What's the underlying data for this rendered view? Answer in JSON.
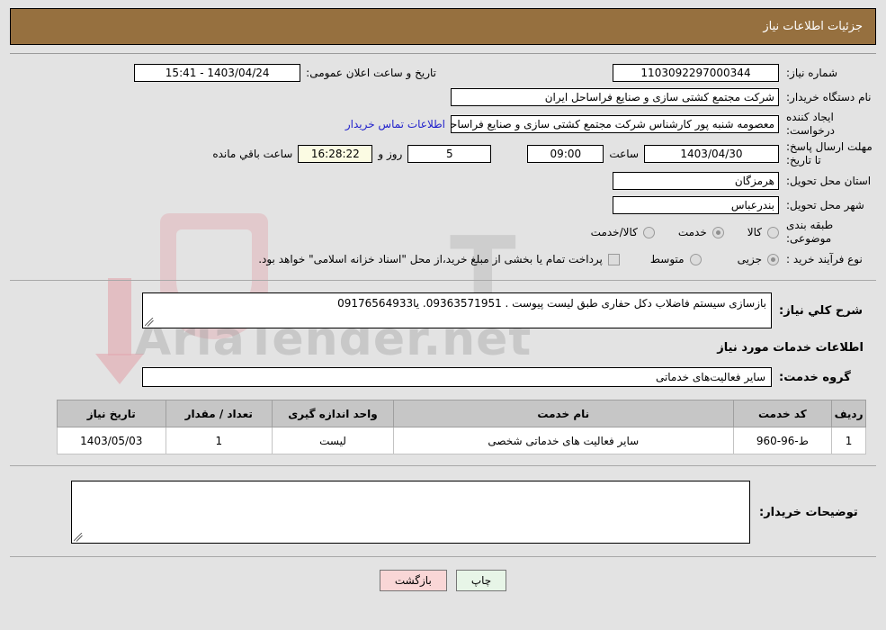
{
  "header": {
    "title": "جزئیات اطلاعات نیاز"
  },
  "details": {
    "need_number_label": "شماره نیاز:",
    "need_number_value": "1103092297000344",
    "public_announce_label": "تاریخ و ساعت اعلان عمومی:",
    "public_announce_value": "1403/04/24 - 15:41",
    "buyer_org_label": "نام دستگاه خریدار:",
    "buyer_org_value": "شرکت مجتمع کشتی سازی و صنایع فراساحل ایران",
    "requester_label": "ایجاد کننده درخواست:",
    "requester_value": "معصومه شنبه پور کارشناس شرکت مجتمع کشتی سازی و صنایع فراساحل ایران",
    "contact_link": "اطلاعات تماس خریدار",
    "deadline_label": "مهلت ارسال پاسخ: تا تاریخ:",
    "deadline_date": "1403/04/30",
    "hour_label": "ساعت",
    "deadline_time": "09:00",
    "days_value": "5",
    "days_label": "روز و",
    "countdown_value": "16:28:22",
    "countdown_label": "ساعت باقي مانده",
    "province_label": "استان محل تحویل:",
    "province_value": "هرمزگان",
    "city_label": "شهر محل تحویل:",
    "city_value": "بندرعباس",
    "category_label": "طبقه بندی موضوعی:",
    "category_options": [
      {
        "label": "کالا",
        "checked": false
      },
      {
        "label": "خدمت",
        "checked": true
      },
      {
        "label": "کالا/خدمت",
        "checked": false
      }
    ],
    "process_label": "نوع فرآیند خرید :",
    "process_options": [
      {
        "label": "جزیی",
        "checked": true
      },
      {
        "label": "متوسط",
        "checked": false
      }
    ],
    "treasury_checkbox_label": "پرداخت تمام یا بخشی از مبلغ خرید،از محل \"اسناد خزانه اسلامی\" خواهد بود.",
    "treasury_checked": false
  },
  "description": {
    "label": "شرح کلي نیاز:",
    "value": "بازسازی سیستم فاضلاب دکل حفاری طبق لیست پیوست . 09363571951. یا09176564933",
    "placeholder": ""
  },
  "services": {
    "section_title": "اطلاعات خدمات مورد نیاز",
    "group_label": "گروه خدمت:",
    "group_value": "سایر فعالیت‌های خدماتی",
    "table": {
      "columns": [
        "ردیف",
        "کد خدمت",
        "نام خدمت",
        "واحد اندازه گیری",
        "تعداد / مقدار",
        "تاریخ نیاز"
      ],
      "rows": [
        [
          "1",
          "ط-96-960",
          "سایر فعالیت های خدماتی شخصی",
          "لیست",
          "1",
          "1403/05/03"
        ]
      ]
    }
  },
  "buyer_comments": {
    "label": "توضیحات خریدار:",
    "value": "",
    "placeholder": ""
  },
  "footer": {
    "print_label": "چاپ",
    "back_label": "بازگشت"
  },
  "watermark": {
    "text": "AriaTender.net",
    "big": "T"
  },
  "colors": {
    "header_bg": "#96703f",
    "page_bg": "#e3e3e3",
    "link": "#2222cc",
    "table_header_bg": "#c6c6c6",
    "print_btn": "#e7f5e7",
    "back_btn": "#f9d6d6",
    "countdown_bg": "#fbfbe3"
  }
}
